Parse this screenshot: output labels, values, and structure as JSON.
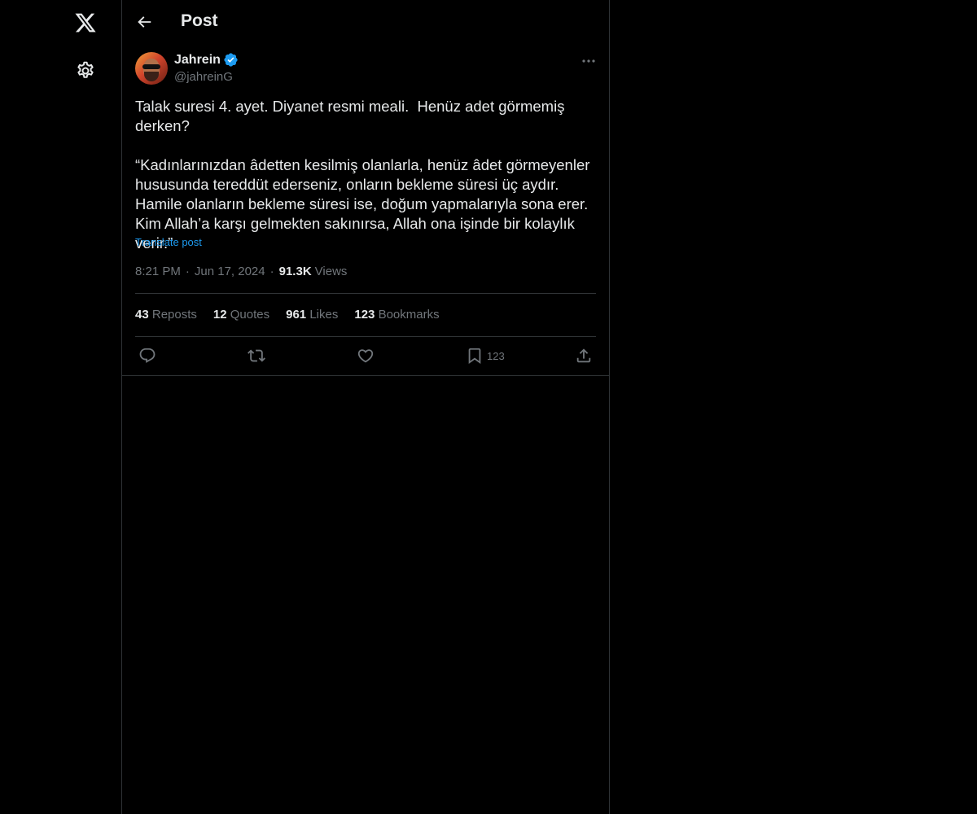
{
  "header": {
    "title": "Post"
  },
  "post": {
    "author": {
      "display_name": "Jahrein",
      "handle": "@jahreinG",
      "verified": true
    },
    "text": "Talak suresi 4. ayet. Diyanet resmi meali.  Henüz adet görmemiş derken?\n\n“Kadınlarınızdan âdetten kesilmiş olanlarla, henüz âdet görmeyenler hususunda tereddüt ederseniz, onların bekleme süresi üç aydır. Hamile olanların bekleme süresi ise, doğum yapmalarıyla sona erer. Kim Allah’a karşı gelmekten sakınırsa, Allah ona işinde bir kolaylık verir.”",
    "translate_label": "Translate post",
    "time": "8:21 PM",
    "separator": "·",
    "date": "Jun 17, 2024",
    "views_count": "91.3K",
    "views_label": "Views",
    "stats": [
      {
        "count": "43",
        "label": "Reposts"
      },
      {
        "count": "12",
        "label": "Quotes"
      },
      {
        "count": "961",
        "label": "Likes"
      },
      {
        "count": "123",
        "label": "Bookmarks"
      }
    ],
    "actions": {
      "reply_icon": "reply-icon",
      "repost_icon": "repost-icon",
      "like_icon": "heart-icon",
      "bookmark_icon": "bookmark-icon",
      "bookmark_count": "123",
      "share_icon": "share-icon"
    }
  },
  "colors": {
    "background": "#000000",
    "text": "#e7e9ea",
    "muted": "#71767b",
    "accent": "#1d9bf0",
    "border": "#2f3336"
  }
}
